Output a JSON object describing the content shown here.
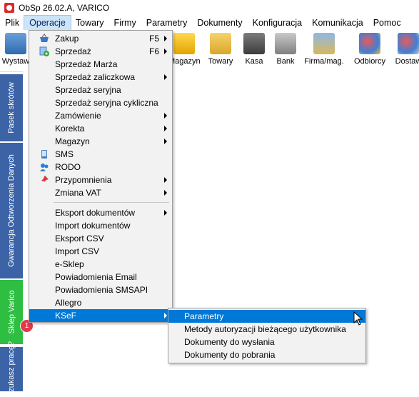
{
  "window": {
    "title": "ObSp 26.02.A, VARICO"
  },
  "menubar": [
    {
      "label": "Plik",
      "active": false
    },
    {
      "label": "Operacje",
      "active": true
    },
    {
      "label": "Towary",
      "active": false
    },
    {
      "label": "Firmy",
      "active": false
    },
    {
      "label": "Parametry",
      "active": false
    },
    {
      "label": "Dokumenty",
      "active": false
    },
    {
      "label": "Konfiguracja",
      "active": false
    },
    {
      "label": "Komunikacja",
      "active": false
    },
    {
      "label": "Pomoc",
      "active": false
    }
  ],
  "toolbar": [
    {
      "label": "Wystaw",
      "icon": "document-icon"
    },
    {
      "label": "Magazyn",
      "icon": "warehouse-icon"
    },
    {
      "label": "Towary",
      "icon": "boxes-icon"
    },
    {
      "label": "Kasa",
      "icon": "cash-register-icon"
    },
    {
      "label": "Bank",
      "icon": "bank-icon"
    },
    {
      "label": "Firma/mag.",
      "icon": "company-icon"
    },
    {
      "label": "Odbiorcy",
      "icon": "customers-icon"
    },
    {
      "label": "Dostaw",
      "icon": "suppliers-icon"
    }
  ],
  "sidetabs": [
    {
      "label": "Pasek skrótów"
    },
    {
      "label": "Gwarancja Odtworzenia Danych"
    },
    {
      "label": "Sklep Varico",
      "badge": "1"
    },
    {
      "label": "Szukasz pracę?"
    }
  ],
  "operacje_menu": [
    {
      "label": "Zakup",
      "shortcut": "F5",
      "submenu": true,
      "icon": "basket-icon"
    },
    {
      "label": "Sprzedaż",
      "shortcut": "F6",
      "submenu": true,
      "icon": "sale-icon"
    },
    {
      "label": "Sprzedaż Marża",
      "shortcut": "",
      "submenu": false
    },
    {
      "label": "Sprzedaż zaliczkowa",
      "shortcut": "",
      "submenu": true
    },
    {
      "label": "Sprzedaż seryjna",
      "shortcut": "",
      "submenu": false
    },
    {
      "label": "Sprzedaż seryjna cykliczna",
      "shortcut": "",
      "submenu": false
    },
    {
      "label": "Zamówienie",
      "shortcut": "",
      "submenu": true
    },
    {
      "label": "Korekta",
      "shortcut": "",
      "submenu": true
    },
    {
      "label": "Magazyn",
      "shortcut": "",
      "submenu": true
    },
    {
      "label": "SMS",
      "shortcut": "",
      "submenu": false,
      "icon": "phone-icon"
    },
    {
      "label": "RODO",
      "shortcut": "",
      "submenu": false,
      "icon": "users-icon"
    },
    {
      "label": "Przypomnienia",
      "shortcut": "",
      "submenu": true,
      "icon": "pin-icon"
    },
    {
      "label": "Zmiana VAT",
      "shortcut": "",
      "submenu": true
    },
    {
      "label": "Eksport dokumentów",
      "shortcut": "",
      "submenu": true
    },
    {
      "label": "Import dokumentów",
      "shortcut": "",
      "submenu": false
    },
    {
      "label": "Eksport CSV",
      "shortcut": "",
      "submenu": false
    },
    {
      "label": "Import CSV",
      "shortcut": "",
      "submenu": false
    },
    {
      "label": "e-Sklep",
      "shortcut": "",
      "submenu": false
    },
    {
      "label": "Powiadomienia Email",
      "shortcut": "",
      "submenu": false
    },
    {
      "label": "Powiadomienia SMSAPI",
      "shortcut": "",
      "submenu": false
    },
    {
      "label": "Allegro",
      "shortcut": "",
      "submenu": false
    },
    {
      "label": "KSeF",
      "shortcut": "",
      "submenu": true,
      "selected": true
    }
  ],
  "ksef_submenu": [
    {
      "label": "Parametry",
      "selected": true
    },
    {
      "label": "Metody autoryzacji bieżącego użytkownika",
      "selected": false
    },
    {
      "label": "Dokumenty do wysłania",
      "selected": false
    },
    {
      "label": "Dokumenty do pobrania",
      "selected": false
    }
  ],
  "colors": {
    "highlight": "#0078d7",
    "sidetab_blue": "#3b63a6",
    "sidetab_green": "#2dbe42",
    "badge": "#e3394a"
  }
}
